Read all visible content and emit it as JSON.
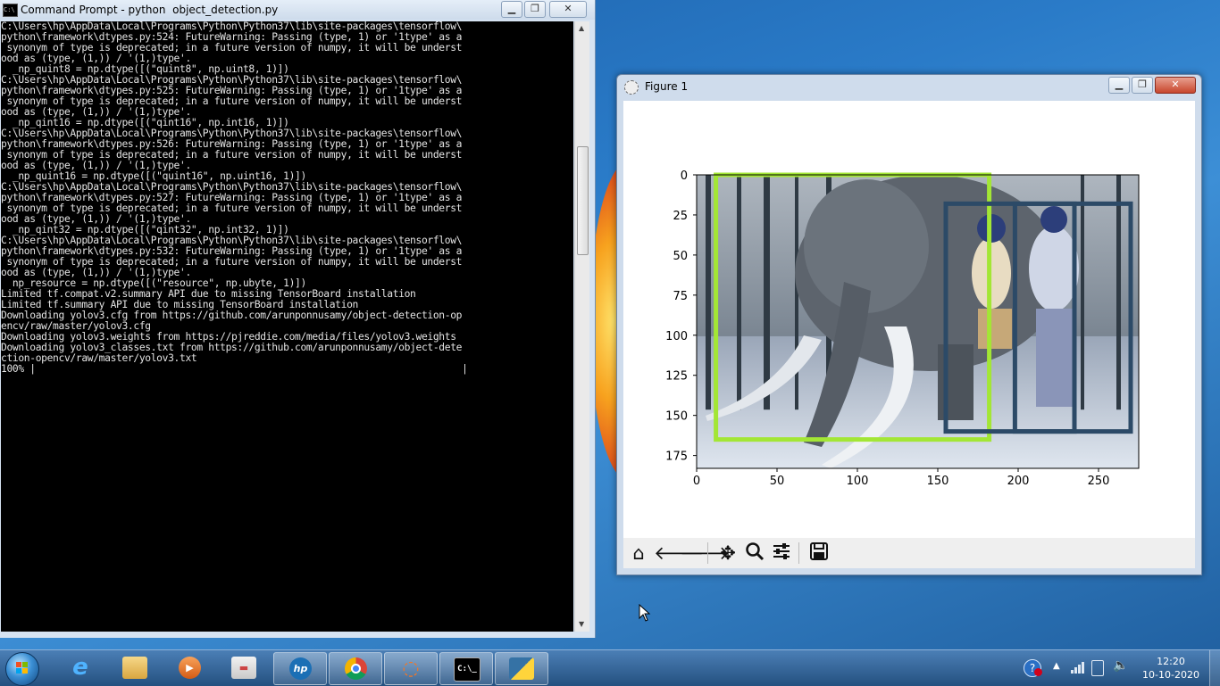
{
  "cmd": {
    "title": "Command Prompt - python  object_detection.py",
    "lines": [
      "C:\\Users\\hp\\AppData\\Local\\Programs\\Python\\Python37\\lib\\site-packages\\tensorflow\\",
      "python\\framework\\dtypes.py:524: FutureWarning: Passing (type, 1) or '1type' as a",
      " synonym of type is deprecated; in a future version of numpy, it will be underst",
      "ood as (type, (1,)) / '(1,)type'.",
      "  _np_quint8 = np.dtype([(\"quint8\", np.uint8, 1)])",
      "C:\\Users\\hp\\AppData\\Local\\Programs\\Python\\Python37\\lib\\site-packages\\tensorflow\\",
      "python\\framework\\dtypes.py:525: FutureWarning: Passing (type, 1) or '1type' as a",
      " synonym of type is deprecated; in a future version of numpy, it will be underst",
      "ood as (type, (1,)) / '(1,)type'.",
      "  _np_qint16 = np.dtype([(\"qint16\", np.int16, 1)])",
      "C:\\Users\\hp\\AppData\\Local\\Programs\\Python\\Python37\\lib\\site-packages\\tensorflow\\",
      "python\\framework\\dtypes.py:526: FutureWarning: Passing (type, 1) or '1type' as a",
      " synonym of type is deprecated; in a future version of numpy, it will be underst",
      "ood as (type, (1,)) / '(1,)type'.",
      "  _np_quint16 = np.dtype([(\"quint16\", np.uint16, 1)])",
      "C:\\Users\\hp\\AppData\\Local\\Programs\\Python\\Python37\\lib\\site-packages\\tensorflow\\",
      "python\\framework\\dtypes.py:527: FutureWarning: Passing (type, 1) or '1type' as a",
      " synonym of type is deprecated; in a future version of numpy, it will be underst",
      "ood as (type, (1,)) / '(1,)type'.",
      "  _np_qint32 = np.dtype([(\"qint32\", np.int32, 1)])",
      "C:\\Users\\hp\\AppData\\Local\\Programs\\Python\\Python37\\lib\\site-packages\\tensorflow\\",
      "python\\framework\\dtypes.py:532: FutureWarning: Passing (type, 1) or '1type' as a",
      " synonym of type is deprecated; in a future version of numpy, it will be underst",
      "ood as (type, (1,)) / '(1,)type'.",
      "  np_resource = np.dtype([(\"resource\", np.ubyte, 1)])",
      "Limited tf.compat.v2.summary API due to missing TensorBoard installation",
      "Limited tf.summary API due to missing TensorBoard installation",
      "Downloading yolov3.cfg from https://github.com/arunponnusamy/object-detection-op",
      "encv/raw/master/yolov3.cfg",
      "Downloading yolov3.weights from https://pjreddie.com/media/files/yolov3.weights",
      "Downloading yolov3_classes.txt from https://github.com/arunponnusamy/object-dete",
      "ction-opencv/raw/master/yolov3.txt",
      "100% |                                                                          |"
    ]
  },
  "figure": {
    "title": "Figure 1",
    "toolbar": [
      "home-icon",
      "back-arrow-icon",
      "forward-arrow-icon",
      "pan-icon",
      "zoom-icon",
      "configure-subplots-icon",
      "save-icon"
    ]
  },
  "chart_data": {
    "type": "image",
    "xticks": [
      0,
      50,
      100,
      150,
      200,
      250
    ],
    "yticks": [
      0,
      25,
      50,
      75,
      100,
      125,
      150,
      175
    ],
    "xlim": [
      0,
      275
    ],
    "ylim": [
      183,
      0
    ],
    "boxes": [
      {
        "x1": 12,
        "y1": 0,
        "x2": 182,
        "y2": 165,
        "color": "#a3e635"
      },
      {
        "x1": 155,
        "y1": 18,
        "x2": 235,
        "y2": 160,
        "color": "#2c4a67"
      },
      {
        "x1": 198,
        "y1": 18,
        "x2": 270,
        "y2": 160,
        "color": "#2c4a67"
      }
    ]
  },
  "taskbar": {
    "apps": [
      "windows-explorer",
      "internet-explorer",
      "file-explorer",
      "media-player",
      "paint",
      "hp-support",
      "chrome",
      "jupyter",
      "command-prompt",
      "python"
    ],
    "time": "12:20",
    "date": "10-10-2020"
  }
}
